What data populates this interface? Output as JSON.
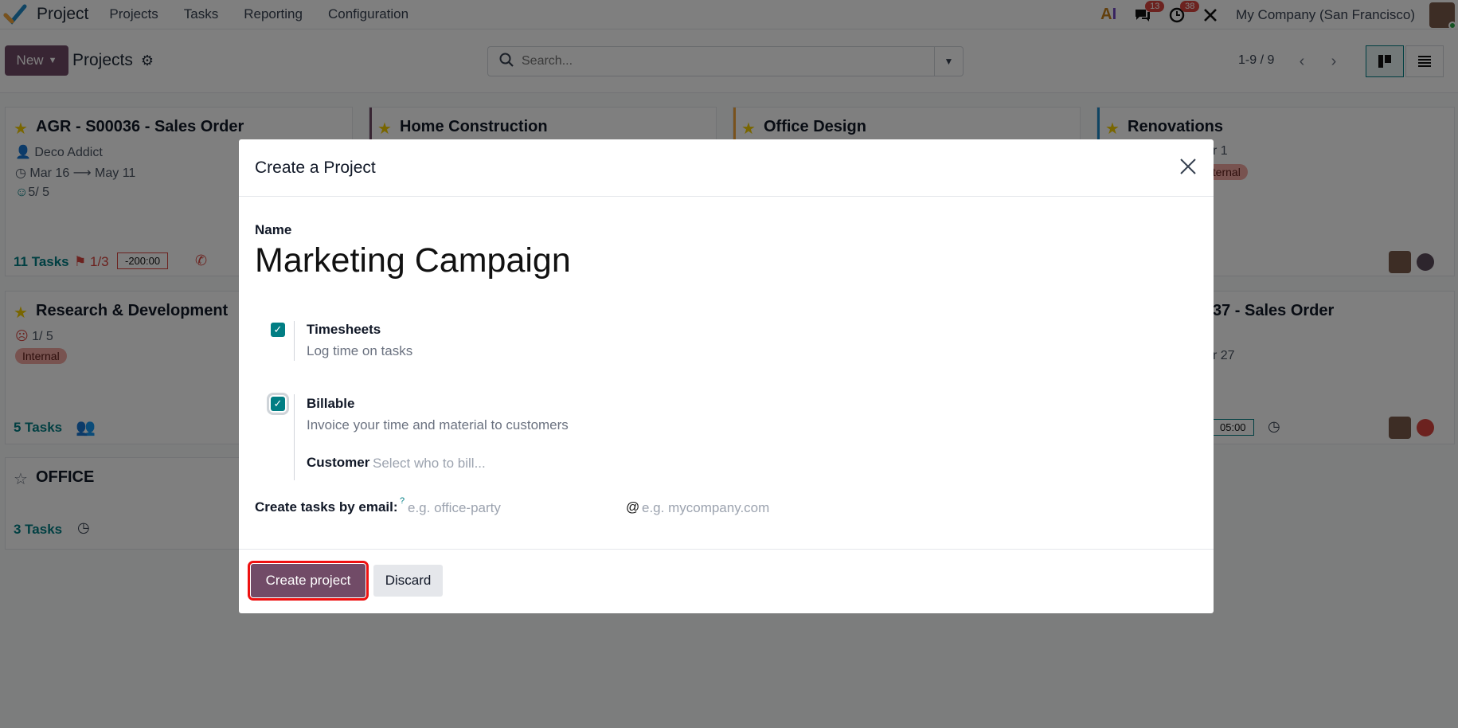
{
  "topnav": {
    "app_title": "Project",
    "menu": [
      "Projects",
      "Tasks",
      "Reporting",
      "Configuration"
    ],
    "messages_count": "13",
    "activities_count": "38",
    "company": "My Company (San Francisco)"
  },
  "control": {
    "new_label": "New",
    "breadcrumb": "Projects",
    "search_placeholder": "Search...",
    "pager": "1-9 / 9"
  },
  "cards": [
    {
      "title": "AGR - S00036 - Sales Order",
      "customer": "Deco Addict",
      "date_start": "Mar 16",
      "date_end": "May 11",
      "rating": "5/ 5",
      "tasks": "11 Tasks",
      "milestones": "1/3",
      "time": "-200:00"
    },
    {
      "title": "Home Construction"
    },
    {
      "title": "Office Design"
    },
    {
      "title": "Renovations",
      "partial_line": "r 1",
      "tag": "nternal"
    },
    {
      "title": "Research & Development",
      "rating": "1/ 5",
      "tag": "Internal",
      "tasks": "5 Tasks"
    },
    {
      "title_partial": "37 - Sales Order",
      "partial_line": "r 27",
      "time": "05:00"
    },
    {
      "title": "OFFICE",
      "tasks": "3 Tasks"
    }
  ],
  "modal": {
    "title": "Create a Project",
    "name_label": "Name",
    "name_value": "Marketing Campaign",
    "timesheets_title": "Timesheets",
    "timesheets_desc": "Log time on tasks",
    "billable_title": "Billable",
    "billable_desc": "Invoice your time and material to customers",
    "customer_label": "Customer",
    "customer_placeholder": "Select who to bill...",
    "email_label": "Create tasks by email:",
    "email_help": "?",
    "email_alias_placeholder": "e.g. office-party",
    "email_at": "@",
    "email_domain_placeholder": "e.g. mycompany.com",
    "create_label": "Create project",
    "discard_label": "Discard"
  },
  "colors": {
    "brand": "#714b67",
    "teal": "#017e84",
    "danger": "#d9453e",
    "star": "#f3cc00"
  }
}
